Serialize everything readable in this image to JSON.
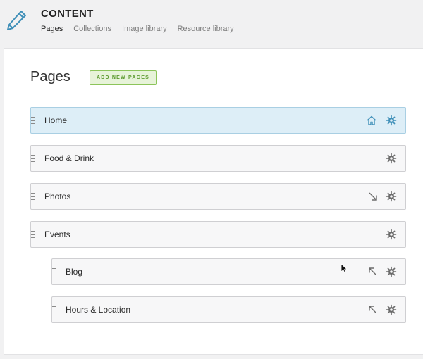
{
  "header": {
    "title": "CONTENT",
    "tabs": [
      {
        "label": "Pages",
        "active": true
      },
      {
        "label": "Collections",
        "active": false
      },
      {
        "label": "Image library",
        "active": false
      },
      {
        "label": "Resource library",
        "active": false
      }
    ]
  },
  "main": {
    "heading": "Pages",
    "add_button_label": "ADD NEW PAGES"
  },
  "pages": [
    {
      "label": "Home",
      "level": 0,
      "selected": true,
      "icons": [
        "home-icon",
        "gear-icon"
      ]
    },
    {
      "label": "Food & Drink",
      "level": 0,
      "selected": false,
      "icons": [
        "gear-icon"
      ]
    },
    {
      "label": "Photos",
      "level": 0,
      "selected": false,
      "icons": [
        "arrow-down-right-icon",
        "gear-icon"
      ]
    },
    {
      "label": "Events",
      "level": 0,
      "selected": false,
      "icons": [
        "gear-icon"
      ]
    },
    {
      "label": "Blog",
      "level": 1,
      "selected": false,
      "icons": [
        "arrow-up-left-icon",
        "gear-icon"
      ]
    },
    {
      "label": "Hours & Location",
      "level": 1,
      "selected": false,
      "icons": [
        "arrow-up-left-icon",
        "gear-icon"
      ]
    }
  ],
  "colors": {
    "accent_blue": "#3f8fb8",
    "button_green": "#5b9a2e",
    "selected_row": "#ddeef7"
  }
}
